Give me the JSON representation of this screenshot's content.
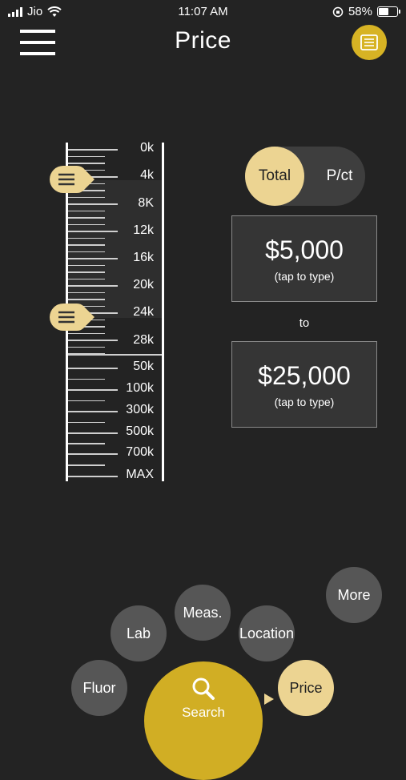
{
  "status_bar": {
    "carrier": "Jio",
    "time": "11:07 AM",
    "battery": "58%",
    "battery_level": 0.58
  },
  "header": {
    "title": "Price",
    "menu_icon": "hamburger-icon",
    "list_icon": "list-icon"
  },
  "scale": {
    "labels": [
      "0k",
      "4k",
      "8K",
      "12k",
      "16k",
      "20k",
      "24k",
      "28k",
      "50k",
      "100k",
      "300k",
      "500k",
      "700k",
      "MAX"
    ],
    "min_handle_label": "4k",
    "max_handle_label": "24k"
  },
  "toggle": {
    "active": "Total",
    "inactive": "P/ct"
  },
  "min_price": {
    "value": "$5,000",
    "hint": "(tap to type)"
  },
  "separator": "to",
  "max_price": {
    "value": "$25,000",
    "hint": "(tap to type)"
  },
  "nav": {
    "more": "More",
    "meas": "Meas.",
    "lab": "Lab",
    "location": "Location",
    "fluor": "Fluor",
    "price": "Price",
    "search": "Search"
  },
  "colors": {
    "accent": "#d1ae24",
    "accent_light": "#ecd492",
    "background": "#232323",
    "button": "#565656"
  }
}
